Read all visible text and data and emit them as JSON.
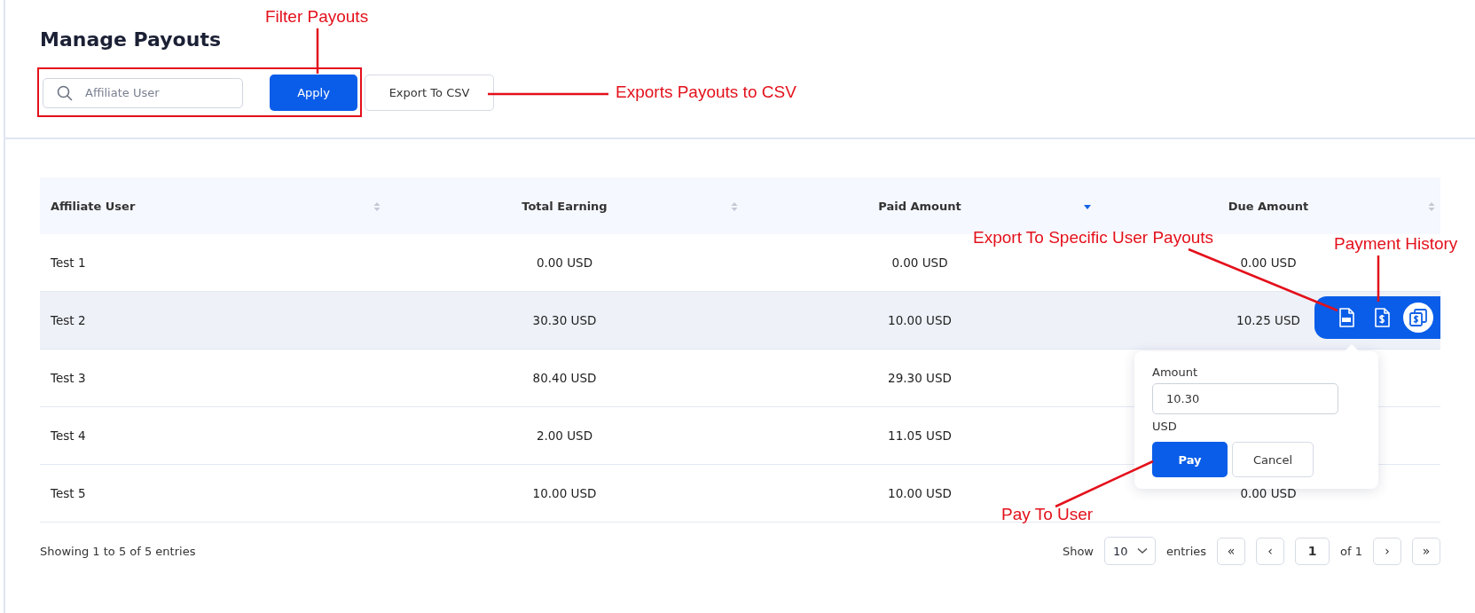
{
  "page": {
    "title": "Manage Payouts"
  },
  "filter": {
    "highlighted": true,
    "search": {
      "placeholder": "Affiliate User"
    },
    "apply": "Apply",
    "export": "Export To CSV"
  },
  "table": {
    "columns": [
      {
        "label": "Affiliate User",
        "sorted": false
      },
      {
        "label": "Total Earning",
        "sorted": false
      },
      {
        "label": "Paid Amount",
        "sorted": true
      },
      {
        "label": "Due Amount",
        "sorted": false
      }
    ],
    "rows": [
      {
        "cells": [
          "Test 1",
          "0.00 USD",
          "0.00 USD",
          "0.00 USD"
        ],
        "highlighted": false
      },
      {
        "cells": [
          "Test 2",
          "30.30 USD",
          "10.00 USD",
          "10.25 USD"
        ],
        "highlighted": true,
        "actions": [
          {
            "kind": "csv",
            "highlighted": false
          },
          {
            "kind": "dollar-file",
            "highlighted": false
          },
          {
            "kind": "dollar-copy",
            "highlighted": true
          }
        ],
        "payout_popover": {
          "label": "Amount",
          "value": "10.30",
          "currency": "USD",
          "pay": "Pay",
          "cancel": "Cancel"
        }
      },
      {
        "cells": [
          "Test 3",
          "80.40 USD",
          "29.30 USD",
          ""
        ],
        "highlighted": false
      },
      {
        "cells": [
          "Test 4",
          "2.00 USD",
          "11.05 USD",
          ""
        ],
        "highlighted": false
      },
      {
        "cells": [
          "Test 5",
          "10.00 USD",
          "10.00 USD",
          "0.00 USD"
        ],
        "highlighted": false
      }
    ]
  },
  "footer": {
    "summary": "Showing 1 to 5 of 5 entries",
    "show_label": "Show",
    "page_size": "10",
    "entries_label": "entries",
    "first": "«",
    "prev": "‹",
    "page": "1",
    "of": "of 1",
    "next": "›",
    "last": "»"
  },
  "annotations": [
    {
      "text": "Filter Payouts"
    },
    {
      "text": "Exports Payouts to CSV"
    },
    {
      "text": "Export To Specific User Payouts"
    },
    {
      "text": "Payment History"
    },
    {
      "text": "Pay To User"
    }
  ]
}
